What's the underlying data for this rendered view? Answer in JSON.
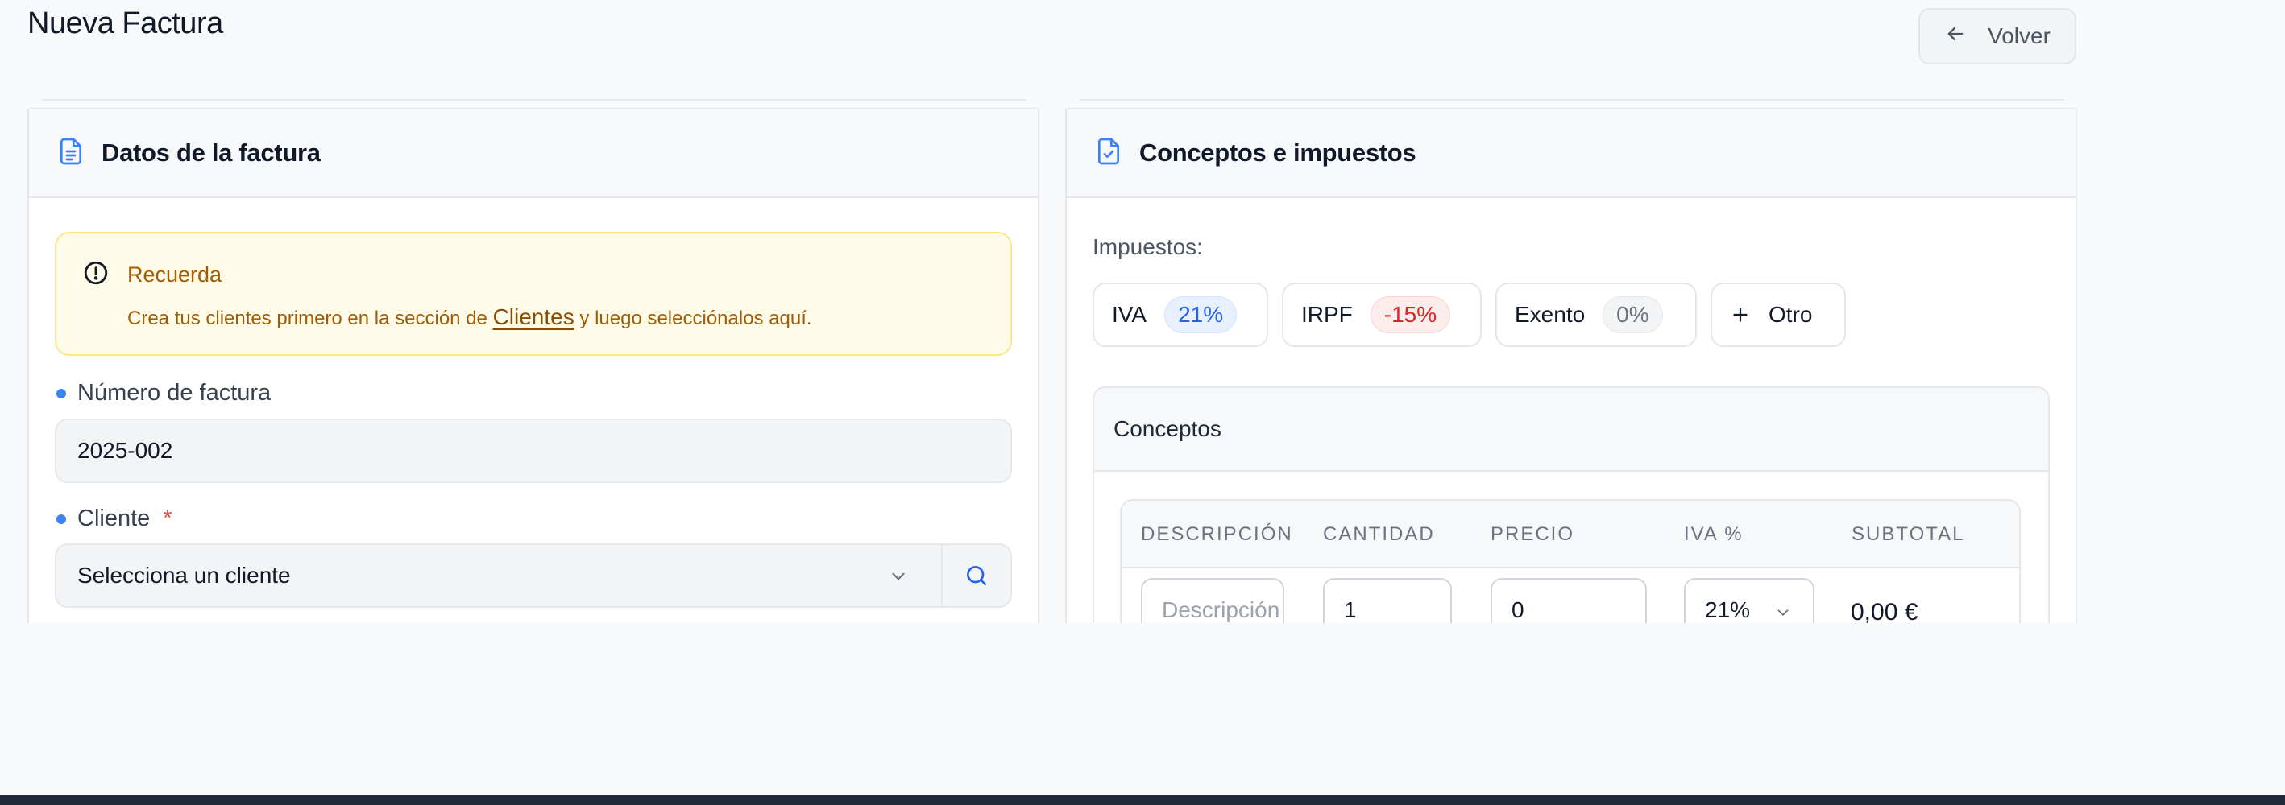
{
  "header": {
    "title": "Nueva Factura",
    "back_label": "Volver"
  },
  "left_card": {
    "title": "Datos de la factura",
    "alert": {
      "title": "Recuerda",
      "text_before": "Crea tus clientes primero en la sección de ",
      "link": "Clientes",
      "text_after": " y luego selecciónalos aquí."
    },
    "invoice_number": {
      "label": "Número de factura",
      "value": "2025-002"
    },
    "client": {
      "label": "Cliente",
      "required_mark": "*",
      "selected": "Selecciona un cliente"
    }
  },
  "right_card": {
    "title": "Conceptos e impuestos",
    "taxes_label": "Impuestos:",
    "taxes": [
      {
        "name": "IVA",
        "rate": "21%"
      },
      {
        "name": "IRPF",
        "rate": "-15%"
      },
      {
        "name": "Exento",
        "rate": "0%"
      }
    ],
    "add_tax_label": "Otro",
    "concepts": {
      "title": "Conceptos",
      "columns": [
        "DESCRIPCIÓN",
        "CANTIDAD",
        "PRECIO",
        "IVA %",
        "SUBTOTAL"
      ],
      "row": {
        "description_placeholder": "Descripción",
        "quantity": "1",
        "price": "0",
        "iva": "21%",
        "subtotal": "0,00 €",
        "delete_symbol": "✕"
      }
    }
  },
  "colors": {
    "accent": "#3b82f6",
    "alert_text": "#a15c07",
    "alert_bg": "#fefce8",
    "danger": "#ef4444"
  },
  "icons": [
    "arrow-left-icon",
    "document-text-icon",
    "document-check-icon",
    "alert-circle-icon",
    "chevron-down-icon",
    "search-icon",
    "plus-icon",
    "close-icon"
  ]
}
